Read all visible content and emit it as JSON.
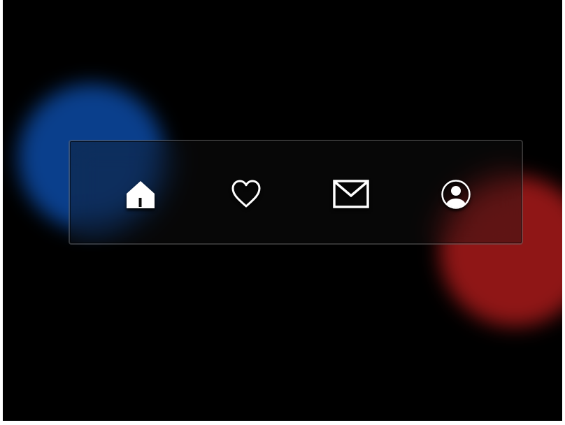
{
  "background": {
    "color": "#000000",
    "blobs": [
      {
        "name": "blue-glow",
        "color": "#0a3f8c"
      },
      {
        "name": "red-glow",
        "color": "#8f1616"
      }
    ]
  },
  "nav_bar": {
    "items": [
      {
        "id": "home",
        "icon": "home-icon",
        "filled": true
      },
      {
        "id": "favorites",
        "icon": "heart-icon",
        "filled": false
      },
      {
        "id": "messages",
        "icon": "mail-icon",
        "filled": false
      },
      {
        "id": "profile",
        "icon": "user-circle-icon",
        "filled": false
      }
    ],
    "icon_color": "#ffffff"
  }
}
